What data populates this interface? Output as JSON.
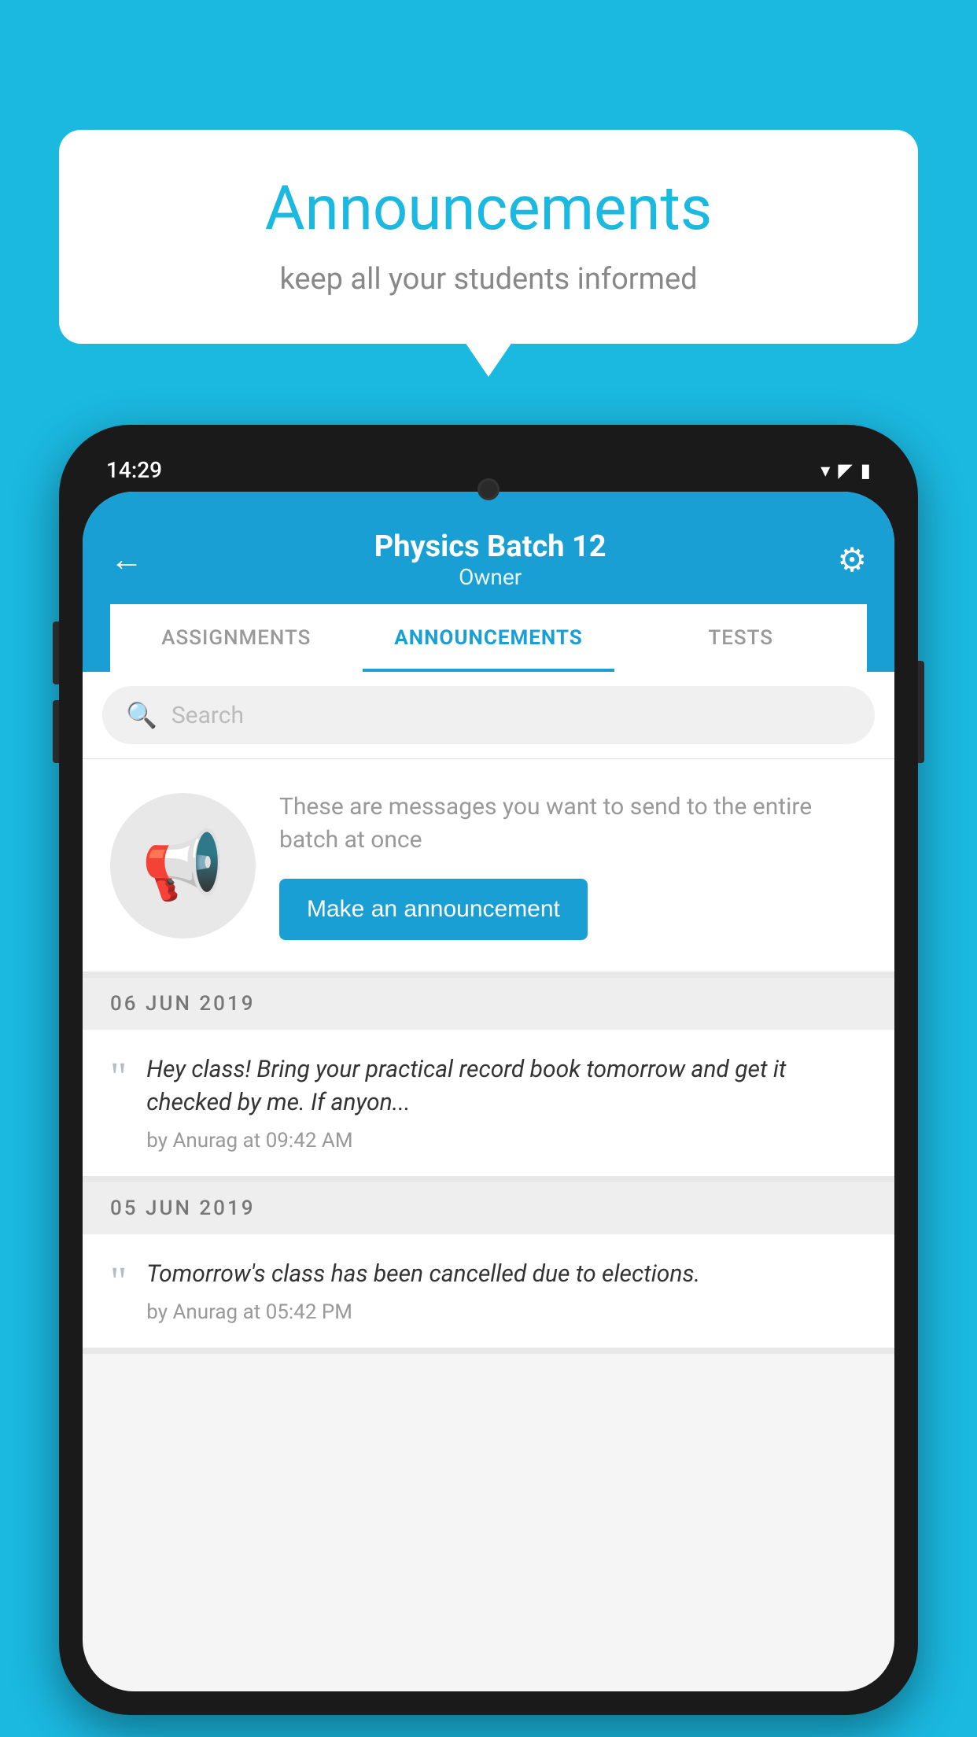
{
  "background": {
    "color": "#1bb8e0"
  },
  "speech_bubble": {
    "title": "Announcements",
    "subtitle": "keep all your students informed"
  },
  "phone": {
    "status_bar": {
      "time": "14:29",
      "wifi": "▾",
      "signal": "▲",
      "battery": "▮"
    },
    "header": {
      "title": "Physics Batch 12",
      "subtitle": "Owner",
      "back_label": "←",
      "settings_label": "⚙"
    },
    "tabs": [
      {
        "label": "ASSIGNMENTS",
        "active": false
      },
      {
        "label": "ANNOUNCEMENTS",
        "active": true
      },
      {
        "label": "TESTS",
        "active": false
      }
    ],
    "search": {
      "placeholder": "Search"
    },
    "announcement_prompt": {
      "description": "These are messages you want to send to the entire batch at once",
      "button_label": "Make an announcement"
    },
    "announcements": [
      {
        "date": "06  JUN  2019",
        "text": "Hey class! Bring your practical record book tomorrow and get it checked by me. If anyon...",
        "meta": "by Anurag at 09:42 AM"
      },
      {
        "date": "05  JUN  2019",
        "text": "Tomorrow's class has been cancelled due to elections.",
        "meta": "by Anurag at 05:42 PM"
      }
    ]
  }
}
